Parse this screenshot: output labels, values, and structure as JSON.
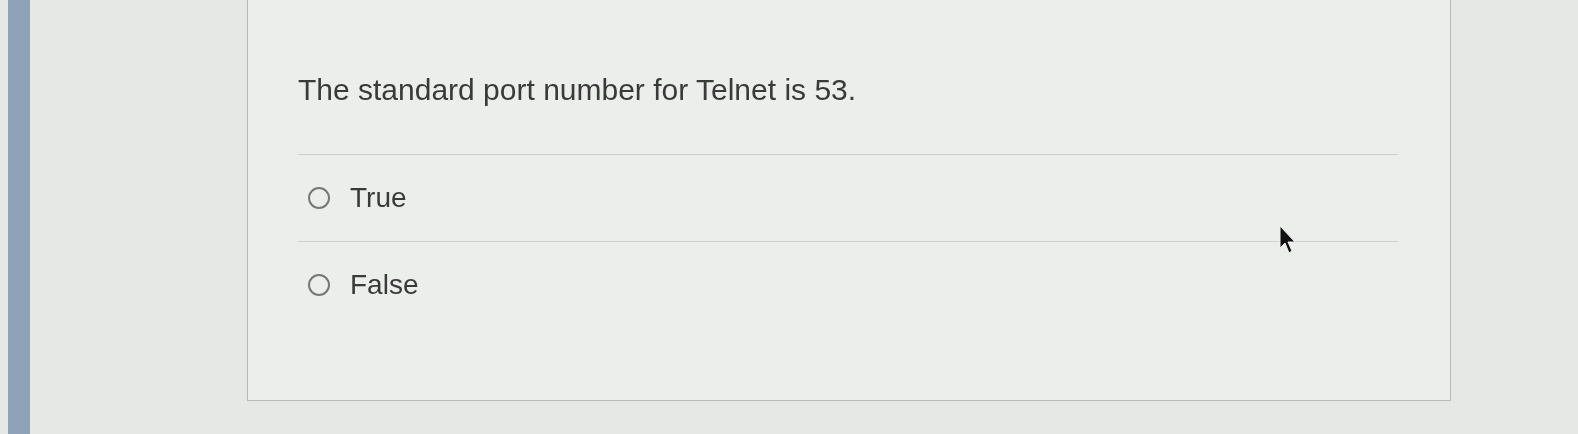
{
  "question": {
    "text": "The standard port number for Telnet is 53.",
    "options": [
      {
        "label": "True",
        "selected": false
      },
      {
        "label": "False",
        "selected": false
      }
    ]
  }
}
